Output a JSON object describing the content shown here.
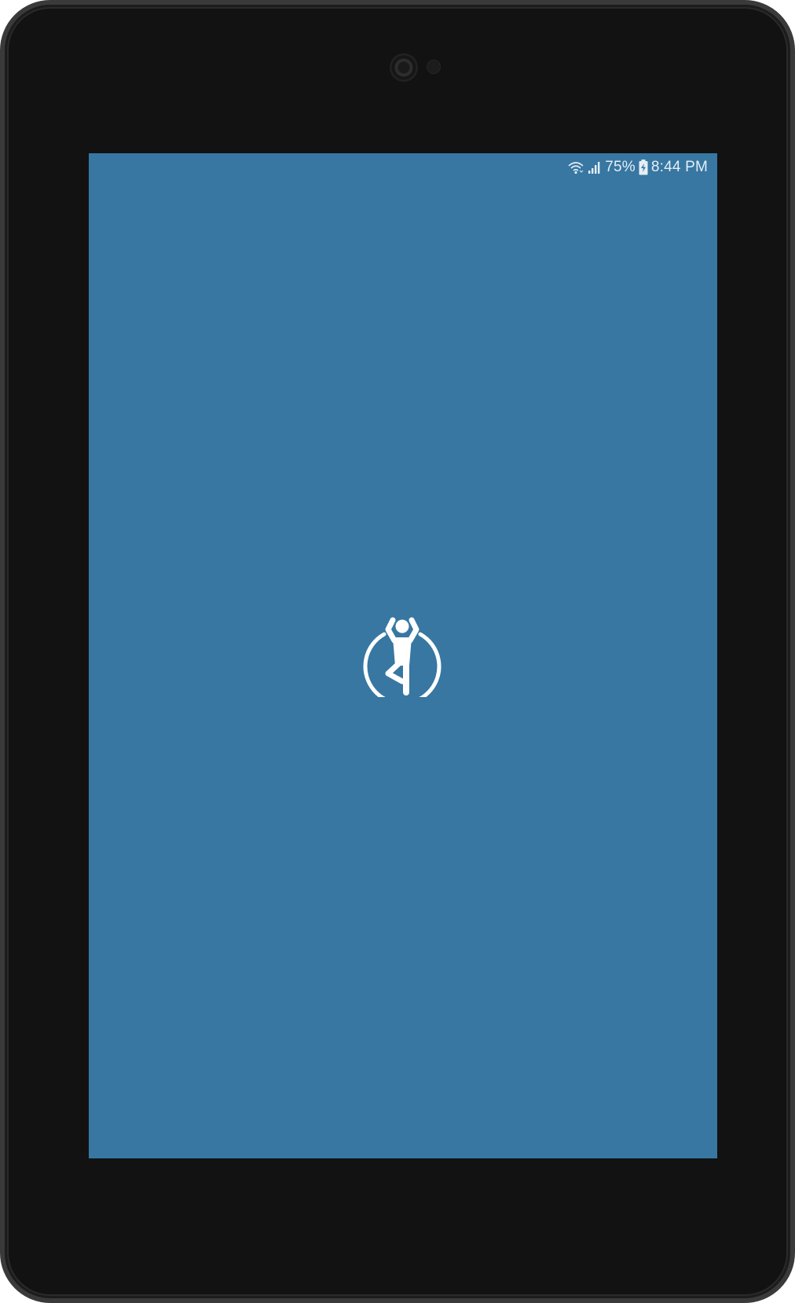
{
  "status_bar": {
    "battery_percent": "75%",
    "time": "8:44 PM",
    "icons": [
      "wifi-icon",
      "signal-icon",
      "battery-charging-icon"
    ]
  },
  "splash": {
    "logo_icon": "yoga-tree-pose-icon"
  },
  "colors": {
    "screen_background": "#3777a2",
    "device_body": "#121212",
    "logo": "#ffffff",
    "status_text": "#e6eef5"
  }
}
